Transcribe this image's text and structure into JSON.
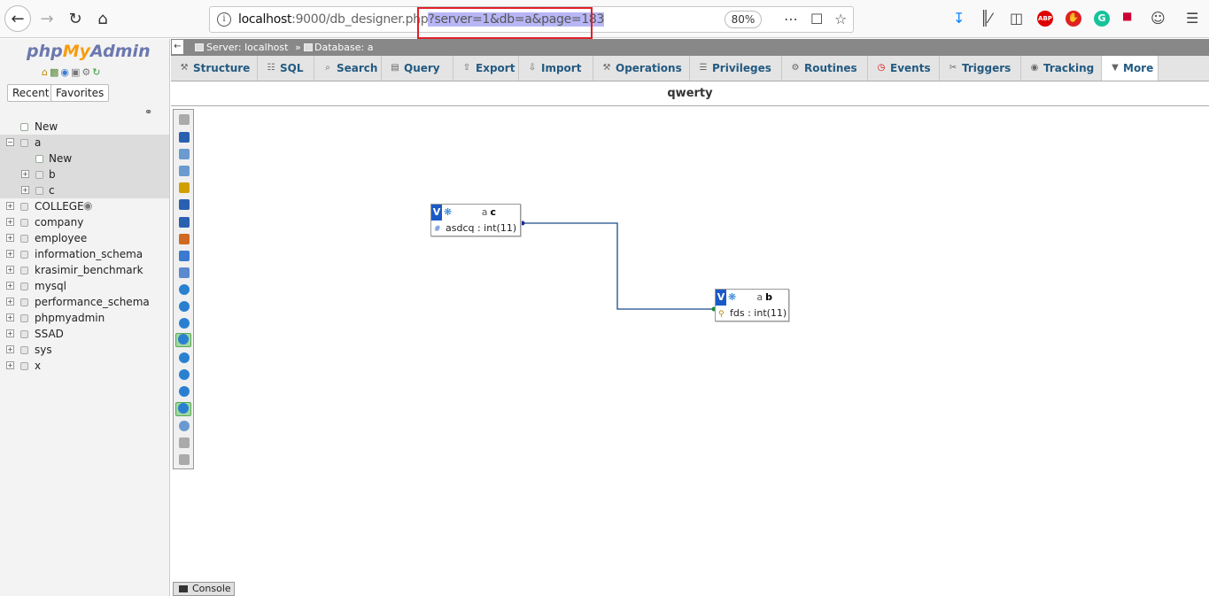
{
  "browser": {
    "url_host": "localhost",
    "url_port_path": ":9000/db_designer.php",
    "url_query": "?server=1&db=a&page=183",
    "zoom": "80%"
  },
  "nav": {
    "logo_php": "php",
    "logo_my": "My",
    "logo_admin": "Admin",
    "recent_label": "Recent",
    "favorites_label": "Favorites",
    "tree": [
      {
        "label": "New",
        "level": 0,
        "type": "new"
      },
      {
        "label": "a",
        "level": 0,
        "type": "db",
        "expanded": true,
        "selected": true
      },
      {
        "label": "New",
        "level": 1,
        "type": "new"
      },
      {
        "label": "b",
        "level": 1,
        "type": "table"
      },
      {
        "label": "c",
        "level": 1,
        "type": "table"
      },
      {
        "label": "COLLEGE",
        "level": 0,
        "type": "db",
        "eye": true
      },
      {
        "label": "company",
        "level": 0,
        "type": "db"
      },
      {
        "label": "employee",
        "level": 0,
        "type": "db"
      },
      {
        "label": "information_schema",
        "level": 0,
        "type": "db"
      },
      {
        "label": "krasimir_benchmark",
        "level": 0,
        "type": "db"
      },
      {
        "label": "mysql",
        "level": 0,
        "type": "db"
      },
      {
        "label": "performance_schema",
        "level": 0,
        "type": "db"
      },
      {
        "label": "phpmyadmin",
        "level": 0,
        "type": "db"
      },
      {
        "label": "SSAD",
        "level": 0,
        "type": "db"
      },
      {
        "label": "sys",
        "level": 0,
        "type": "db"
      },
      {
        "label": "x",
        "level": 0,
        "type": "db"
      }
    ]
  },
  "breadcrumb": {
    "server": "Server: localhost",
    "separator": "»",
    "database": "Database: a"
  },
  "tabs": [
    {
      "label": "Structure",
      "icon": "structure-icon"
    },
    {
      "label": "SQL",
      "icon": "sql-icon"
    },
    {
      "label": "Search",
      "icon": "search-icon"
    },
    {
      "label": "Query",
      "icon": "query-icon"
    },
    {
      "label": "Export",
      "icon": "export-icon"
    },
    {
      "label": "Import",
      "icon": "import-icon"
    },
    {
      "label": "Operations",
      "icon": "wrench-icon"
    },
    {
      "label": "Privileges",
      "icon": "privileges-icon"
    },
    {
      "label": "Routines",
      "icon": "routines-icon"
    },
    {
      "label": "Events",
      "icon": "clock-icon"
    },
    {
      "label": "Triggers",
      "icon": "triggers-icon"
    },
    {
      "label": "Tracking",
      "icon": "eye-icon"
    },
    {
      "label": "More",
      "icon": "triangle-down-icon"
    }
  ],
  "page_title": "qwerty",
  "designer": {
    "tables": [
      {
        "db": "a",
        "name": "c",
        "field": "asdcq : int(11)",
        "field_icon": "hash-icon"
      },
      {
        "db": "a",
        "name": "b",
        "field": "fds : int(11)",
        "field_icon": "key-icon"
      }
    ],
    "v_label": "V"
  },
  "console_label": "Console"
}
